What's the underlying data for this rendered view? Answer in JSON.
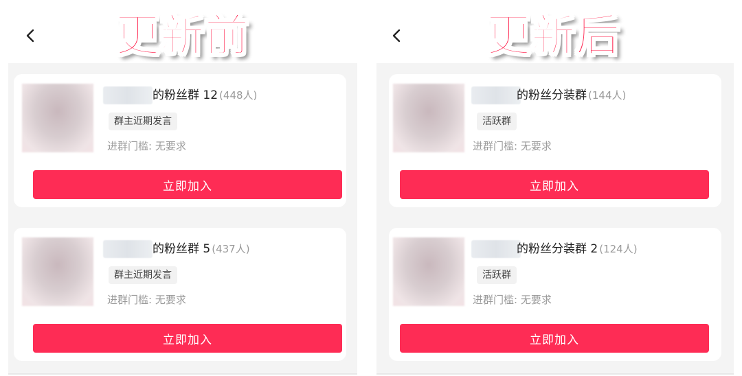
{
  "panels": [
    {
      "overlay_title": "更新前",
      "cards": [
        {
          "group_name": "的粉丝群 12",
          "member_count": "(448人)",
          "tag": "群主近期发言",
          "threshold": "进群门槛: 无要求",
          "join_label": "立即加入"
        },
        {
          "group_name": "的粉丝群 5",
          "member_count": "(437人)",
          "tag": "群主近期发言",
          "threshold": "进群门槛: 无要求",
          "join_label": "立即加入"
        }
      ]
    },
    {
      "overlay_title": "更新后",
      "cards": [
        {
          "group_name": "的粉丝分装群",
          "member_count": "(144人)",
          "tag": "活跃群",
          "threshold": "进群门槛: 无要求",
          "join_label": "立即加入"
        },
        {
          "group_name": "的粉丝分装群 2",
          "member_count": "(124人)",
          "tag": "活跃群",
          "threshold": "进群门槛: 无要求",
          "join_label": "立即加入"
        }
      ]
    }
  ],
  "colors": {
    "accent_button": "#fe2c55",
    "overlay_title": "#ff1744",
    "list_background": "#f4f4f4"
  },
  "icons": {
    "back": "chevron-left-icon"
  }
}
